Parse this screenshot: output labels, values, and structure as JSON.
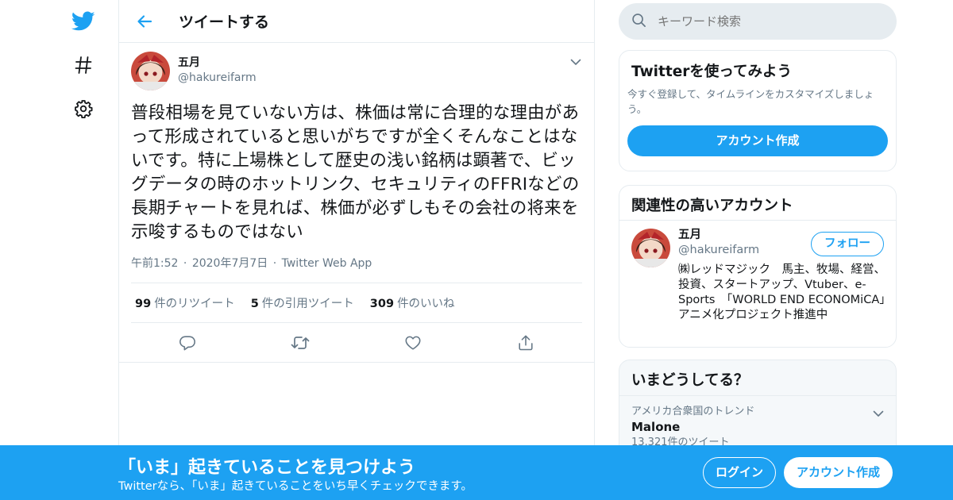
{
  "nav": {
    "icons": [
      "twitter-bird-icon",
      "hashtag-icon",
      "gear-icon"
    ]
  },
  "header": {
    "title": "ツイートする"
  },
  "tweet": {
    "display_name": "五月",
    "handle": "@hakureifarm",
    "text": "普段相場を見ていない方は、株価は常に合理的な理由があって形成されていると思いがちですが全くそんなことはないです。特に上場株として歴史の浅い銘柄は顕著で、ビッグデータの時のホットリンク、セキュリティのFFRIなどの長期チャートを見れば、株価が必ずしもその会社の将来を示唆するものではない",
    "time": "午前1:52",
    "dot1": "·",
    "date": "2020年7月7日",
    "dot2": "·",
    "source": "Twitter Web App",
    "stats": {
      "retweets_count": "99",
      "retweets_label": "件のリツイート",
      "quotes_count": "5",
      "quotes_label": "件の引用ツイート",
      "likes_count": "309",
      "likes_label": "件のいいね"
    }
  },
  "search": {
    "placeholder": "キーワード検索"
  },
  "try_card": {
    "title": "Twitterを使ってみよう",
    "description": "今すぐ登録して、タイムラインをカスタマイズしましょう。",
    "button": "アカウント作成"
  },
  "related": {
    "title": "関連性の高いアカウント",
    "user": {
      "display_name": "五月",
      "handle": "@hakureifarm",
      "bio": "㈱レッドマジック　馬主、牧場、経営、投資、スタートアップ、Vtuber、e-Sports　「WORLD END ECONOMiCA」アニメ化プロジェクト推進中",
      "follow_label": "フォロー"
    }
  },
  "trends": {
    "title": "いまどうしてる？",
    "item": {
      "context": "アメリカ合衆国のトレンド",
      "name": "Malone",
      "count": "13,321件のツイート"
    }
  },
  "banner": {
    "title": "「いま」起きていることを見つけよう",
    "subtitle": "Twitterなら、「いま」起きていることをいち早くチェックできます。",
    "login": "ログイン",
    "signup": "アカウント作成"
  },
  "colors": {
    "brand": "#1da1f2",
    "text": "#14171a",
    "secondary": "#657786",
    "border": "#e6ecf0"
  }
}
